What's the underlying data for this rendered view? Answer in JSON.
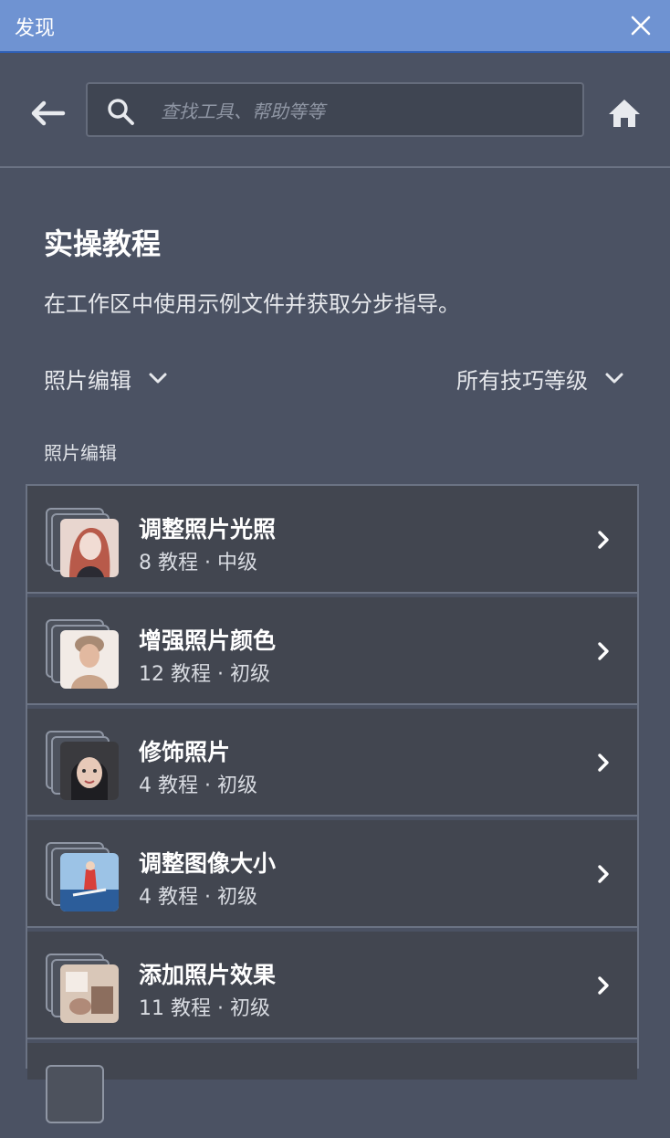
{
  "window": {
    "title": "发现"
  },
  "search": {
    "placeholder": "查找工具、帮助等等"
  },
  "section": {
    "title": "实操教程",
    "description": "在工作区中使用示例文件并获取分步指导。"
  },
  "filters": {
    "category": "照片编辑",
    "level": "所有技巧等级"
  },
  "group_label": "照片编辑",
  "tutorials": [
    {
      "title": "调整照片光照",
      "meta": "8 教程 · 中级",
      "thumb_colors": [
        "#e8d6cf",
        "#b85a4a"
      ]
    },
    {
      "title": "增强照片颜色",
      "meta": "12 教程 · 初级",
      "thumb_colors": [
        "#f2ebe6",
        "#c9a48a"
      ]
    },
    {
      "title": "修饰照片",
      "meta": "4 教程 · 初级",
      "thumb_colors": [
        "#3a3a3e",
        "#e7c9b8"
      ]
    },
    {
      "title": "调整图像大小",
      "meta": "4 教程 · 初级",
      "thumb_colors": [
        "#9cc3e6",
        "#2c5d9a"
      ]
    },
    {
      "title": "添加照片效果",
      "meta": "11 教程 · 初级",
      "thumb_colors": [
        "#d9c7b8",
        "#8c6e5e"
      ]
    }
  ],
  "icons": {
    "close": "close-icon",
    "back": "back-arrow-icon",
    "search": "search-icon",
    "home": "home-icon",
    "dropdown": "chevron-down-icon",
    "item": "chevron-right-icon"
  }
}
